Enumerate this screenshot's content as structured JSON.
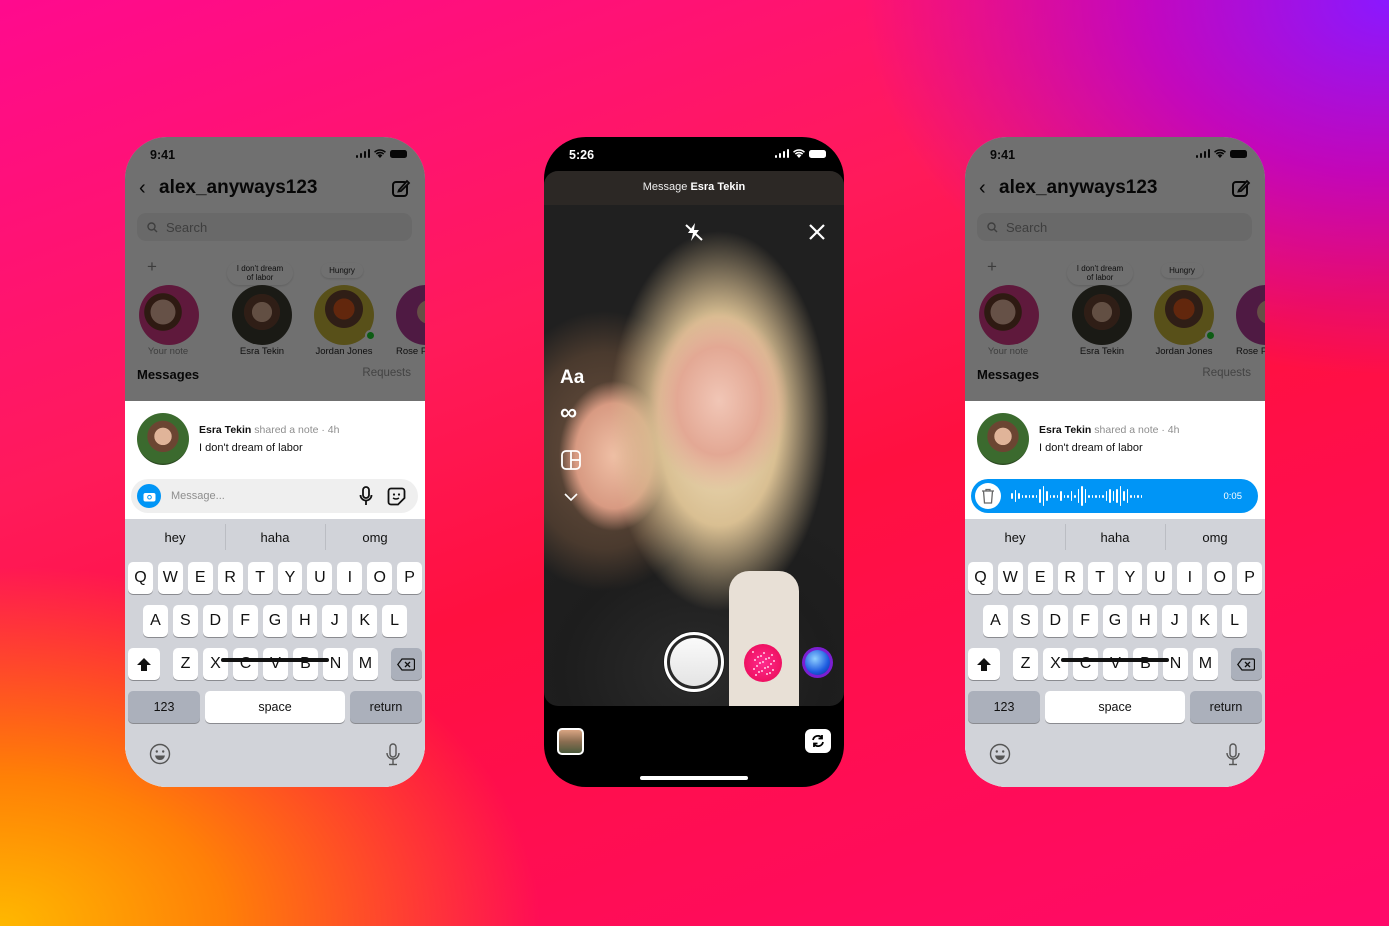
{
  "colors": {
    "accent_blue": "#0095f6",
    "online_green": "#1ed12e",
    "bg_top_left": "#ff0a8e",
    "bg_top_right": "#8a18ff",
    "bg_bottom_left": "#ffb800",
    "bg_bottom_right": "#ff0a6a"
  },
  "phones": {
    "left": {
      "status": {
        "time": "9:41"
      },
      "header": {
        "back_icon": "chevron-left-icon",
        "username": "alex_anyways123",
        "compose_icon": "compose-icon"
      },
      "search": {
        "placeholder": "Search"
      },
      "notes": [
        {
          "name": "Your note",
          "bubble": "",
          "has_add": true
        },
        {
          "name": "Esra Tekin",
          "bubble": "I don't dream of labor"
        },
        {
          "name": "Jordan Jones",
          "bubble": "Hungry",
          "online": true
        },
        {
          "name": "Rose Pad"
        }
      ],
      "messages_title": "Messages",
      "requests_label": "Requests",
      "share": {
        "name": "Esra Tekin",
        "action": "shared a note · 4h",
        "note": "I don't dream of labor"
      },
      "composer": {
        "placeholder": "Message..."
      },
      "keyboard": {
        "suggestions": [
          "hey",
          "haha",
          "omg"
        ],
        "row1": [
          "Q",
          "W",
          "E",
          "R",
          "T",
          "Y",
          "U",
          "I",
          "O",
          "P"
        ],
        "row2": [
          "A",
          "S",
          "D",
          "F",
          "G",
          "H",
          "J",
          "K",
          "L"
        ],
        "row3": [
          "Z",
          "X",
          "C",
          "V",
          "B",
          "N",
          "M"
        ],
        "numbers": "123",
        "space": "space",
        "return": "return"
      }
    },
    "middle": {
      "status": {
        "time": "5:26"
      },
      "header_prefix": "Message",
      "header_name": "Esra Tekin",
      "tools": [
        "flash-off-icon",
        "close-icon",
        "text-tool-icon",
        "boomerang-icon",
        "layout-icon",
        "chevron-down-icon"
      ],
      "text_tool_label": "Aa",
      "infinity_label": "∞"
    },
    "right": {
      "status": {
        "time": "9:41"
      },
      "header": {
        "username": "alex_anyways123"
      },
      "search": {
        "placeholder": "Search"
      },
      "notes": [
        {
          "name": "Your note"
        },
        {
          "name": "Esra Tekin",
          "bubble": "I don't dream of labor"
        },
        {
          "name": "Jordan Jones",
          "bubble": "Hungry",
          "online": true
        },
        {
          "name": "Rose Pad"
        }
      ],
      "messages_title": "Messages",
      "requests_label": "Requests",
      "share": {
        "name": "Esra Tekin",
        "action": "shared a note · 4h",
        "note": "I don't dream of labor"
      },
      "voice": {
        "duration": "0:05"
      },
      "keyboard": {
        "suggestions": [
          "hey",
          "haha",
          "omg"
        ],
        "numbers": "123",
        "space": "space",
        "return": "return"
      }
    }
  }
}
